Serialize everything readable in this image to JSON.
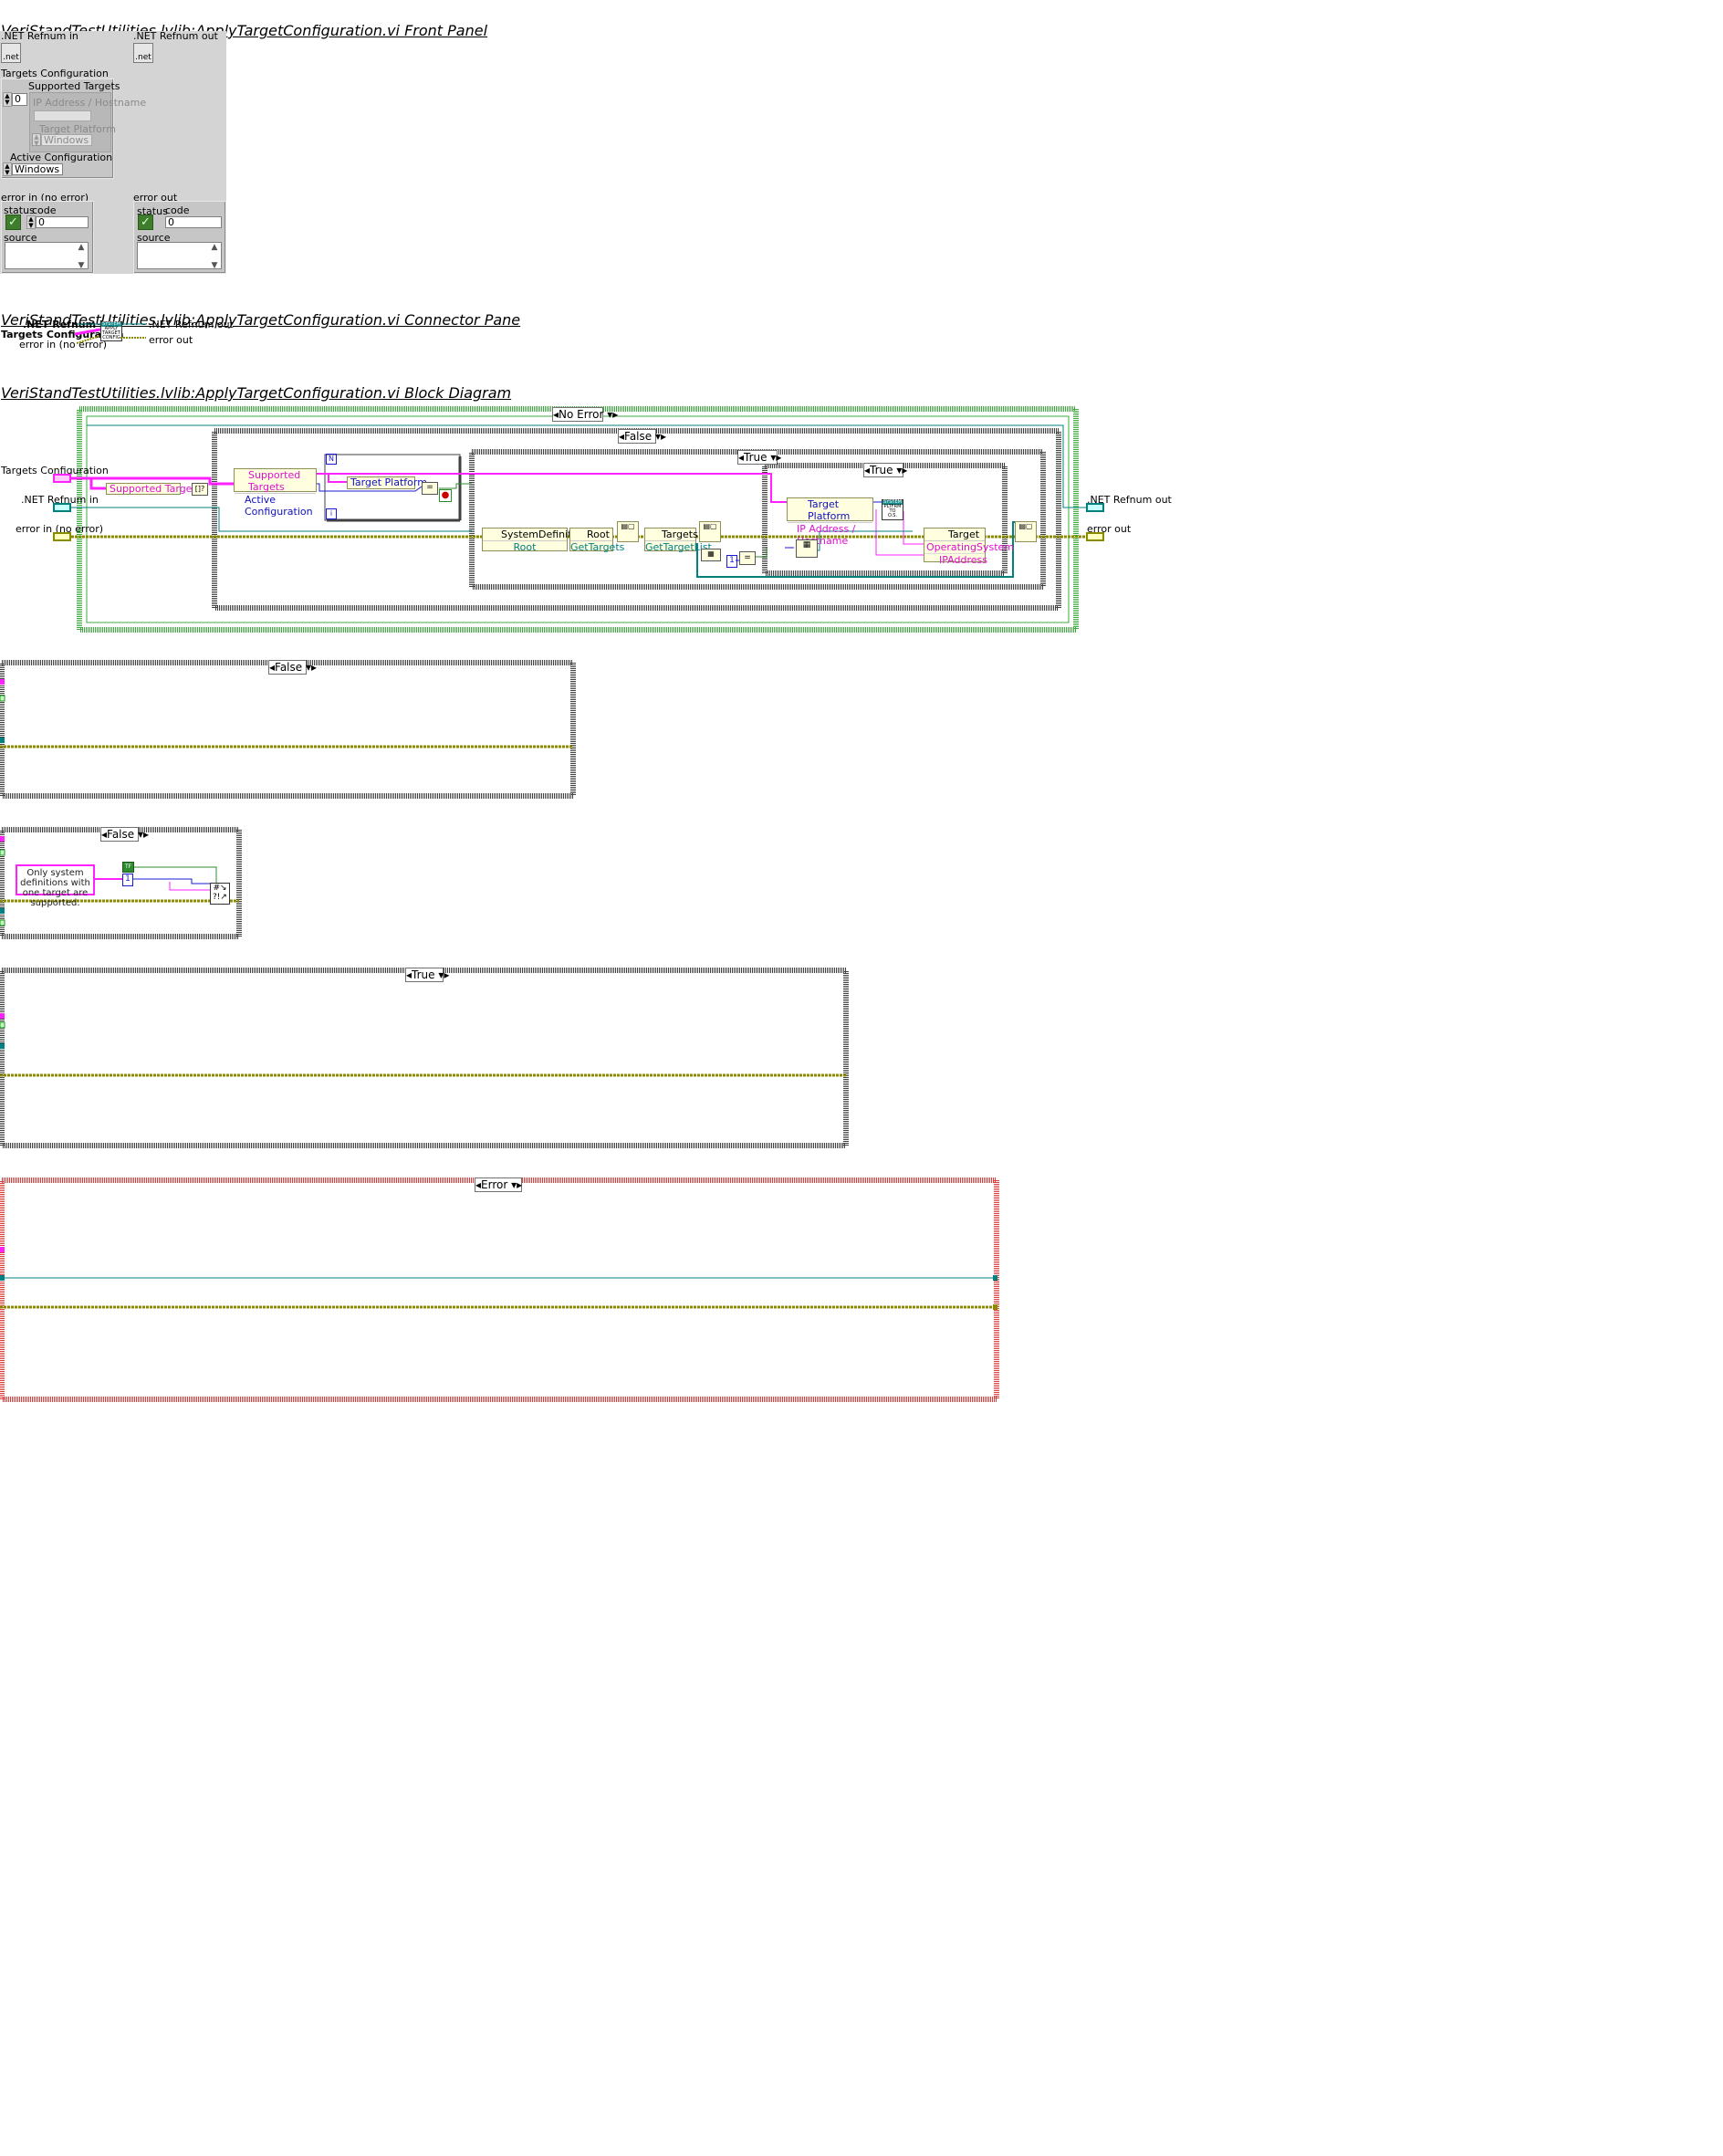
{
  "front_panel": {
    "title": "VeriStandTestUtilities.lvlib:ApplyTargetConfiguration.vi Front Panel",
    "net_refnum_in_label": ".NET Refnum in",
    "net_refnum_out_label": ".NET Refnum out",
    "net_icon_text": ".net",
    "targets_config_label": "Targets Configuration",
    "supported_targets_label": "Supported Targets",
    "index_value": "0",
    "ip_address_label": "IP Address / Hostname",
    "target_platform_label": "Target Platform",
    "target_platform_value": "Windows",
    "active_config_label": "Active Configuration",
    "active_config_value": "Windows",
    "error_in": {
      "label": "error in (no error)",
      "status_label": "status",
      "code_label": "code",
      "code_value": "0",
      "source_label": "source"
    },
    "error_out": {
      "label": "error out",
      "status_label": "status",
      "code_label": "code",
      "code_value": "0",
      "source_label": "source"
    }
  },
  "connector_pane": {
    "title": "VeriStandTestUtilities.lvlib:ApplyTargetConfiguration.vi Connector Pane",
    "in_refnum": ".NET Refnum in",
    "in_targets": "Targets Configuration",
    "in_error": "error in (no error)",
    "out_refnum": ".NET Refnum out",
    "out_error": "error out",
    "icon_lines": [
      "SYSTEM",
      "APPLY",
      "TARGET",
      "CONFIG"
    ]
  },
  "block_diagram": {
    "title": "VeriStandTestUtilities.lvlib:ApplyTargetConfiguration.vi Block Diagram",
    "terminals": {
      "targets_config": "Targets Configuration",
      "net_refnum_in": ".NET Refnum in",
      "error_in": "error in (no error)",
      "net_refnum_out": ".NET Refnum out",
      "error_out": "error out"
    },
    "outer_case": "No Error",
    "false_case": "False",
    "true_case_1": "True",
    "true_case_2": "True",
    "unbundle_supported": "Supported Targets",
    "unbundle_targets_cfg": [
      "Supported Targets",
      "Active Configuration"
    ],
    "unbundle_platform": "Target Platform",
    "loop_index": "i",
    "loop_stop": "N",
    "sysdef_node": "SystemDefinition",
    "sysdef_prop": "Root",
    "root_node": "Root",
    "root_method": "GetTargets",
    "targets_node": "Targets",
    "targets_method": "GetTargetList",
    "unbundle_inner": [
      "Target Platform",
      "IP Address / Hostname"
    ],
    "platform_icon": [
      "SYSTEM",
      "PLTFRM",
      "TO",
      "O.S."
    ],
    "target_node": "Target",
    "target_props": [
      "OperatingSystem",
      "IPAddress"
    ],
    "const_one": "1"
  },
  "subdiagrams": {
    "case_false_1": "False",
    "case_false_2": "False",
    "error_message": "Only system definitions with one target are supported.",
    "const_true": "TF",
    "const_one": "1",
    "case_true": "True",
    "case_error": "Error"
  },
  "colors": {
    "cluster_wire": "#ff22ff",
    "refnum_wire": "#008080",
    "error_wire": "#8b8b00",
    "blue_wire": "#1a1ad6",
    "green_wire": "#2e8b2e",
    "no_error_border": "#3caa3c",
    "error_border": "#e03a3a"
  }
}
